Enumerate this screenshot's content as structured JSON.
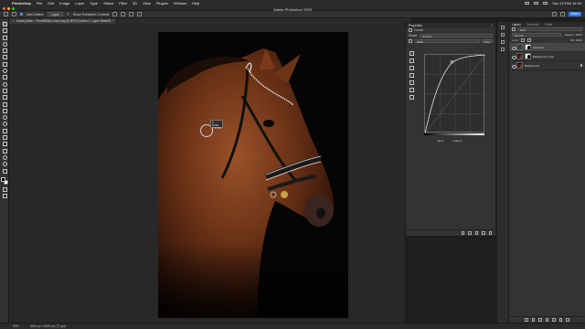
{
  "menubar": {
    "app": "Photoshop",
    "items": [
      "File",
      "Edit",
      "Image",
      "Layer",
      "Type",
      "Select",
      "Filter",
      "3D",
      "View",
      "Plugins",
      "Window",
      "Help"
    ],
    "clock": "Sun 12 Feb 14:34"
  },
  "window": {
    "title": "Adobe Photoshop 2023",
    "traffic_colors": [
      "#ff5f57",
      "#febc2e",
      "#28c840"
    ]
  },
  "options": {
    "auto_select_label": "Auto-Select:",
    "auto_select_value": "Layer",
    "transform_label": "Show Transform Controls",
    "share_label": "Share"
  },
  "document": {
    "tab_label": "horse-pelton - PexelsElliot Lowe.png @ 50% (Curves 1, Layer Mask/8) *"
  },
  "cursor": {
    "tooltip_line1": "X: 42.5%",
    "tooltip_line2": "Y: 57.5%"
  },
  "properties": {
    "title": "Properties",
    "type_label": "Curves",
    "preset_label": "Preset:",
    "preset_value": "Custom",
    "channel_value": "RGB",
    "auto_label": "Auto",
    "input_label": "Input:",
    "output_label": "Output:"
  },
  "layers": {
    "tabs": [
      "Layers",
      "Channels",
      "Paths"
    ],
    "filter_label": "Kind",
    "blend_mode": "Normal",
    "opacity_label": "Opacity: 100%",
    "lock_label": "Lock:",
    "fill_label": "Fill: 100%",
    "items": [
      {
        "name": "Curves 1",
        "selected": true
      },
      {
        "name": "Background copy",
        "selected": false
      },
      {
        "name": "Background",
        "selected": false
      }
    ]
  },
  "status": {
    "zoom": "50%",
    "doc_info": "3540 px x 5300 px (72 ppi)"
  }
}
